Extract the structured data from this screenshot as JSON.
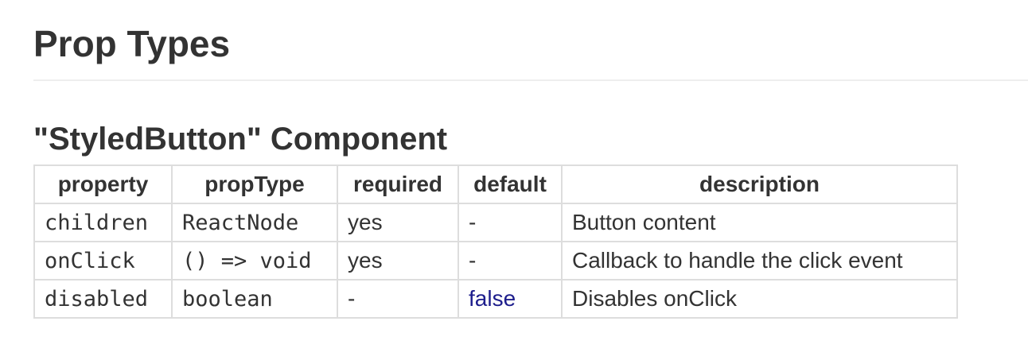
{
  "page_title": "Prop Types",
  "component_title": "\"StyledButton\" Component",
  "table": {
    "headers": [
      "property",
      "propType",
      "required",
      "default",
      "description"
    ],
    "rows": [
      {
        "property": "children",
        "propType": "ReactNode",
        "required": "yes",
        "default": "-",
        "description": "Button content"
      },
      {
        "property": "onClick",
        "propType": "() => void",
        "required": "yes",
        "default": "-",
        "description": "Callback to handle the click event"
      },
      {
        "property": "disabled",
        "propType": "boolean",
        "required": "-",
        "default": "false",
        "description": "Disables onClick"
      }
    ]
  },
  "colors": {
    "text": "#333333",
    "border": "#dddddd",
    "rule": "#eeeeee",
    "default_value": "#1d1d8c"
  }
}
